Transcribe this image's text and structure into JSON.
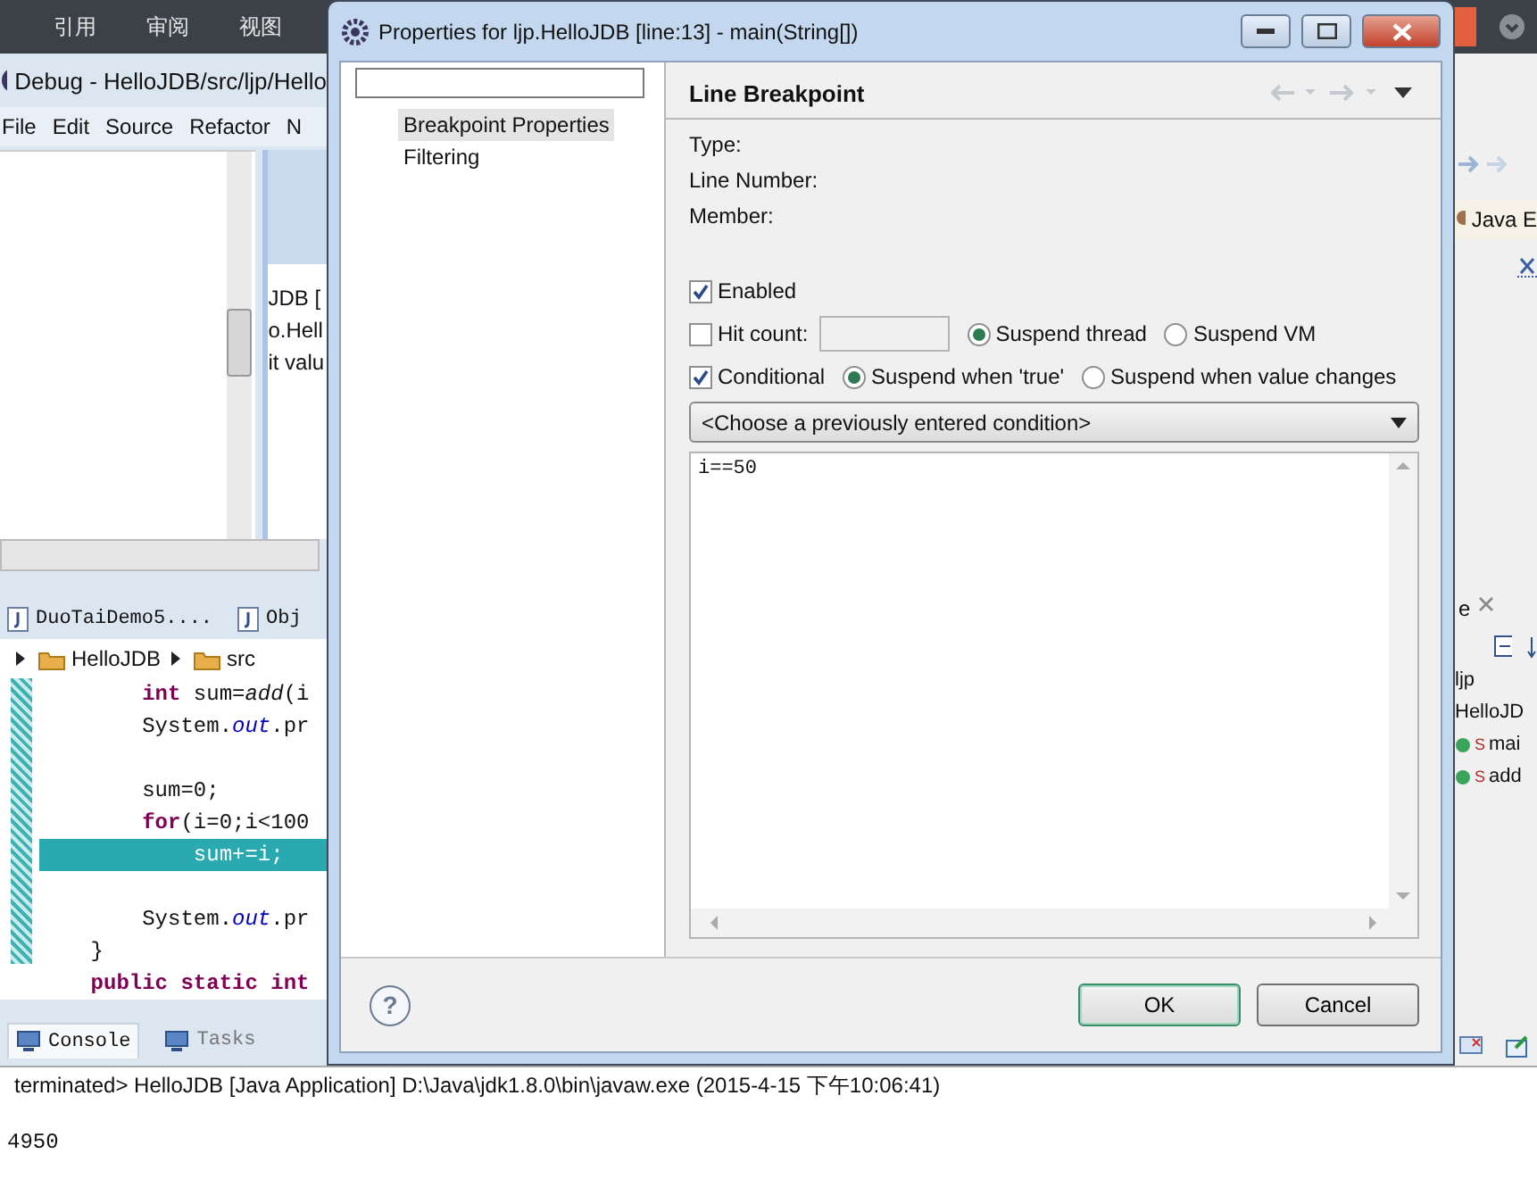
{
  "word_ribbon": {
    "tabs": [
      "引用",
      "审阅",
      "视图"
    ]
  },
  "eclipse": {
    "title": "Debug - HelloJDB/src/ljp/Hello",
    "menu": [
      "File",
      "Edit",
      "Source",
      "Refactor",
      "N"
    ],
    "variables_lines": [
      "JDB [",
      "o.Hell",
      "it valu"
    ],
    "editor_tabs": [
      "DuoTaiDemo5....",
      "Obj"
    ],
    "breadcrumb": [
      "HelloJDB",
      "src"
    ],
    "code_lines": [
      {
        "kind": "code",
        "highlighted": false,
        "segments": [
          {
            "kind": "keyword",
            "text": "        int"
          },
          {
            "kind": "plain",
            "text": " sum="
          },
          {
            "kind": "method",
            "text": "add"
          },
          {
            "kind": "plain",
            "text": "(i"
          }
        ]
      },
      {
        "kind": "code",
        "highlighted": false,
        "segments": [
          {
            "kind": "plain",
            "text": "        System."
          },
          {
            "kind": "field",
            "text": "out"
          },
          {
            "kind": "plain",
            "text": ".pr"
          }
        ]
      },
      {
        "kind": "blank",
        "highlighted": false
      },
      {
        "kind": "code",
        "highlighted": false,
        "segments": [
          {
            "kind": "plain",
            "text": "        sum=0;"
          }
        ]
      },
      {
        "kind": "code",
        "highlighted": false,
        "segments": [
          {
            "kind": "keyword",
            "text": "        for"
          },
          {
            "kind": "plain",
            "text": "(i=0;i<100"
          }
        ]
      },
      {
        "kind": "code",
        "highlighted": true,
        "segments": [
          {
            "kind": "plain",
            "text": "            sum+=i;"
          }
        ]
      },
      {
        "kind": "blank",
        "highlighted": false
      },
      {
        "kind": "code",
        "highlighted": false,
        "segments": [
          {
            "kind": "plain",
            "text": "        System."
          },
          {
            "kind": "field",
            "text": "out"
          },
          {
            "kind": "plain",
            "text": ".pr"
          }
        ]
      },
      {
        "kind": "code",
        "highlighted": false,
        "segments": [
          {
            "kind": "plain",
            "text": "    }"
          }
        ]
      },
      {
        "kind": "code",
        "highlighted": false,
        "segments": [
          {
            "kind": "keyword",
            "text": "    public static int"
          }
        ]
      }
    ],
    "console_tabs": [
      {
        "label": "Console",
        "selected": true
      },
      {
        "label": "Tasks",
        "selected": false
      }
    ],
    "console_status": "terminated> HelloJDB [Java Application] D:\\Java\\jdk1.8.0\\bin\\javaw.exe (2015-4-15 下午10:06:41)",
    "console_output": "4950",
    "perspective": "Java E",
    "outline_tab": "e",
    "outline": [
      {
        "kind": "package",
        "label": "ljp"
      },
      {
        "kind": "class",
        "label": "HelloJD"
      },
      {
        "kind": "method",
        "label": "mai",
        "modifier": "S"
      },
      {
        "kind": "method",
        "label": "add",
        "modifier": "S"
      }
    ]
  },
  "dialog": {
    "title": "Properties for ljp.HelloJDB [line:13] - main(String[])",
    "nav": [
      {
        "label": "Breakpoint Properties",
        "selected": true
      },
      {
        "label": "Filtering",
        "selected": false
      }
    ],
    "page_title": "Line Breakpoint",
    "info_labels": [
      "Type:",
      "Line Number:",
      "Member:"
    ],
    "enabled": {
      "label": "Enabled",
      "checked": true
    },
    "hit_count": {
      "label": "Hit count:",
      "checked": false
    },
    "suspend_options": [
      {
        "label": "Suspend thread",
        "selected": true
      },
      {
        "label": "Suspend VM",
        "selected": false
      }
    ],
    "conditional": {
      "label": "Conditional",
      "checked": true
    },
    "condition_options": [
      {
        "label": "Suspend when 'true'",
        "selected": true
      },
      {
        "label": "Suspend when value changes",
        "selected": false
      }
    ],
    "condition_history": "<Choose a previously entered condition>",
    "condition": "i==50",
    "help": "?",
    "buttons": [
      {
        "label": "OK",
        "default": true
      },
      {
        "label": "Cancel",
        "default": false
      }
    ]
  }
}
